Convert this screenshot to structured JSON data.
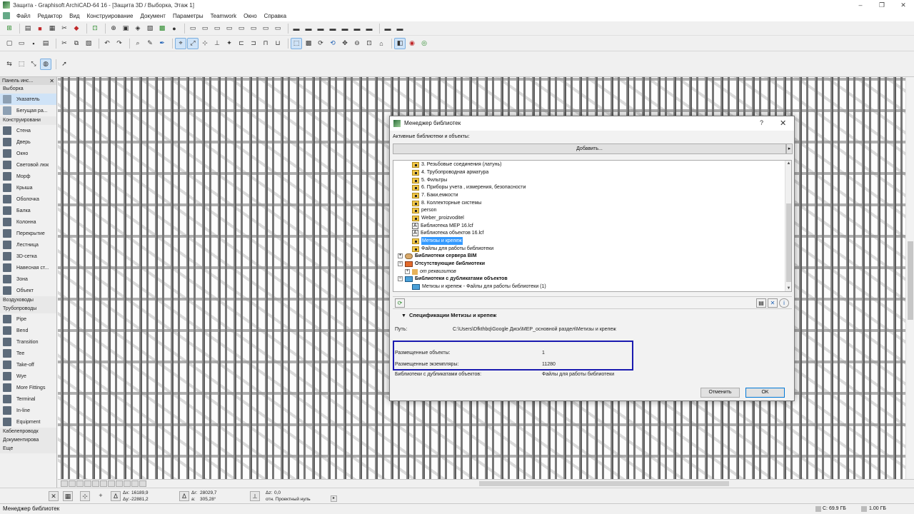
{
  "window": {
    "title": "Защита - Graphisoft ArchiCAD-64 16 - [Защита 3D / Выборка, Этаж 1]",
    "controls": [
      "–",
      "❐",
      "✕"
    ]
  },
  "menu": [
    "Файл",
    "Редактор",
    "Вид",
    "Конструирование",
    "Документ",
    "Параметры",
    "Teamwork",
    "Окно",
    "Справка"
  ],
  "toolbox": {
    "header": "Панель инс...",
    "select_group": "Выборка",
    "select_tools": [
      "Указатель",
      "Бегущая ра..."
    ],
    "design_group": "Конструировани",
    "design_tools": [
      "Стена",
      "Дверь",
      "Окно",
      "Световой люк",
      "Морф",
      "Крыша",
      "Оболочка",
      "Балка",
      "Колонна",
      "Перекрытие",
      "Лестница",
      "3D-сетка",
      "Навесная ст...",
      "Зона",
      "Объект"
    ],
    "mep_groups": [
      "Воздуховоды",
      "Трубопроводы"
    ],
    "pipe_tools": [
      "Pipe",
      "Bend",
      "Transition",
      "Tee",
      "Take-off",
      "Wye",
      "More Fittings",
      "Terminal",
      "In-line",
      "Equipment"
    ],
    "more_groups": [
      "Кабелепроводк",
      "Документирова",
      "Еще"
    ]
  },
  "coordbar": {
    "dx_label": "Δx:",
    "dx": "16189,9",
    "dy_label": "Δy:",
    "dy": "-22881,2",
    "x_label": "Δr:",
    "x": "28029,7",
    "a_label": "a:",
    "a": "305,28°",
    "dz_label": "Δz:",
    "dz": "0,0",
    "ref_label": "отн. Проектный нуль"
  },
  "statusbar": {
    "left": "Менеджер библиотек",
    "disk_c": "C: 69.9 ГБ",
    "memory": "1.00 ГБ"
  },
  "dialog": {
    "title": "Менеджер библиотек",
    "help": "?",
    "close": "✕",
    "active_label": "Активные библиотеки и объекты:",
    "add_button": "Добавить...",
    "tree": {
      "subfolders": [
        "3. Резьбовые соединения (латунь)",
        "4. Трубопроводная арматура",
        "5. Фильтры",
        "6. Приборы учета , измерения, безопасности",
        "7. Баки,емкости",
        "8. Коллекторные системы",
        "person",
        "Weber_proizvoditel"
      ],
      "lcf_files": [
        "Библиотека MEP 16.lcf",
        "Библиотека объектов 16.lcf"
      ],
      "selected": "Метизы и крепеж",
      "after_selected": "Файлы для работы библиотеки",
      "bim_server": "Библиотеки сервера BIM",
      "missing": "Отсутствующие библиотеки",
      "missing_child": "от реквизитов",
      "duplicates": "Библиотеки с дубликатами объектов",
      "duplicates_child": "Метизы и крепеж - Файлы для работы библиотеки (1)"
    },
    "spec": {
      "title": "Спецификации Метизы и крепеж",
      "path_label": "Путь:",
      "path_value": "C:\\Users\\Dfkthbq\\Google Диск\\MEP_основной раздел\\Метизы и крепеж",
      "placed_objects_label": "Размещенные объекты:",
      "placed_objects_value": "1",
      "placed_instances_label": "Размещенные экземпляры:",
      "placed_instances_value": "11280",
      "dup_label": "Библиотеки с дубликатами объектов:",
      "dup_value": "Файлы для работы библиотеки"
    },
    "cancel_button": "Отменить",
    "ok_button": "OK"
  }
}
